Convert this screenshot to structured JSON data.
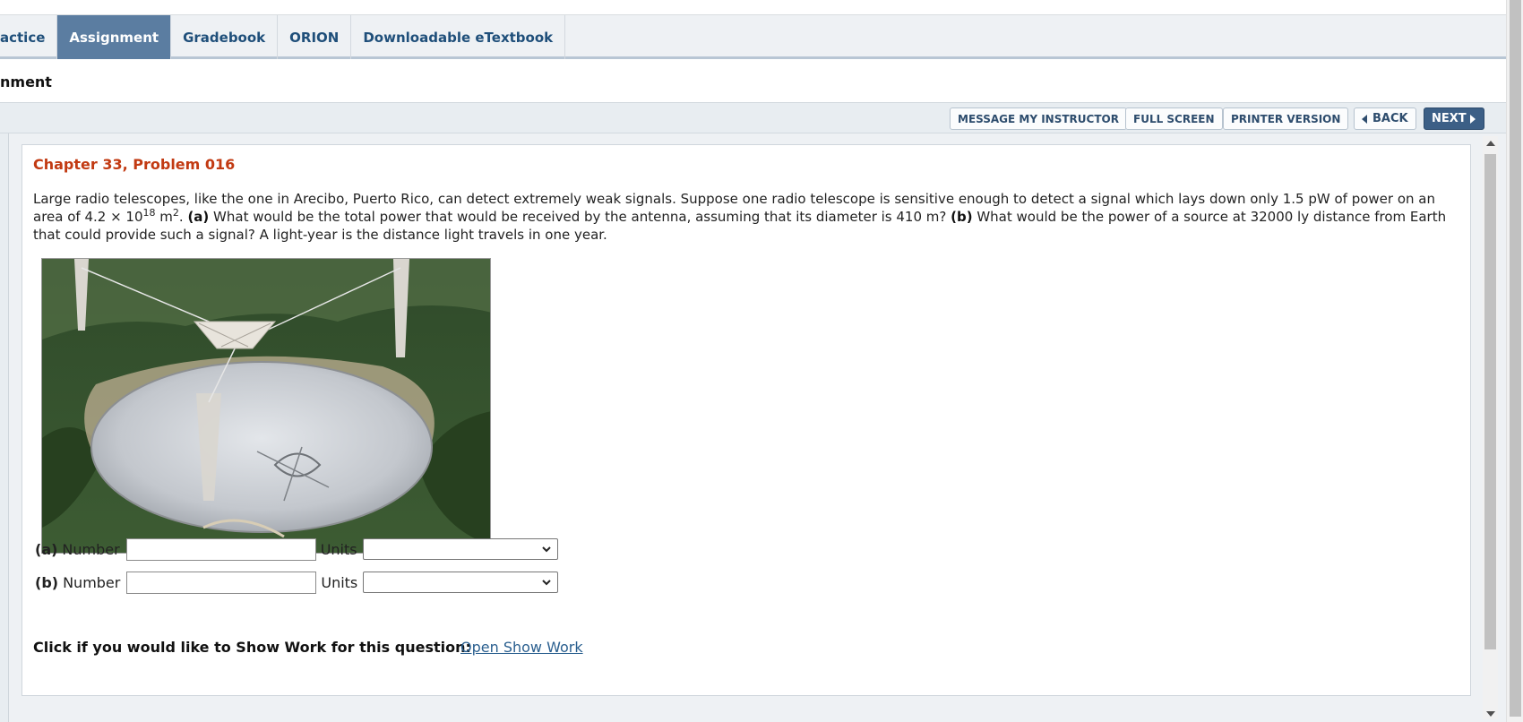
{
  "top_strip_text": "",
  "tabs": [
    {
      "label": "actice",
      "active": false
    },
    {
      "label": "Assignment",
      "active": true
    },
    {
      "label": "Gradebook",
      "active": false
    },
    {
      "label": "ORION",
      "active": false
    },
    {
      "label": "Downloadable eTextbook",
      "active": false
    }
  ],
  "page_title": "nment",
  "actions": {
    "message": "MESSAGE MY INSTRUCTOR",
    "fullscreen": "FULL SCREEN",
    "printer": "PRINTER VERSION",
    "back": "BACK",
    "next": "NEXT"
  },
  "problem": {
    "title": "Chapter 33, Problem 016",
    "text_1": "Large radio telescopes, like the one in Arecibo, Puerto Rico, can detect extremely weak signals. Suppose one radio telescope is sensitive enough to detect a signal which lays down only 1.5 pW of power on an area of 4.2 × 10",
    "exp_1": "18",
    "text_2": " m",
    "exp_2": "2",
    "text_3": ". ",
    "part_a_marker": "(a)",
    "text_4": " What would be the total power that would be received by the antenna, assuming that its diameter is 410 m? ",
    "part_b_marker": "(b)",
    "text_5": " What would be the power of a source at 32000 ly distance from Earth that could provide such a signal? A light-year is the distance light travels in one year."
  },
  "answers": [
    {
      "part": "(a)",
      "number_label": "Number",
      "number_value": "",
      "units_label": "Units",
      "units_value": ""
    },
    {
      "part": "(b)",
      "number_label": "Number",
      "number_value": "",
      "units_label": "Units",
      "units_value": ""
    }
  ],
  "show_work": {
    "prompt": "Click if you would like to Show Work for this question:",
    "link": "Open Show Work"
  },
  "colors": {
    "tab_active_bg": "#5b7da1",
    "problem_title": "#c23a12",
    "next_button_bg": "#3c5f86",
    "link": "#2a5f8f"
  }
}
